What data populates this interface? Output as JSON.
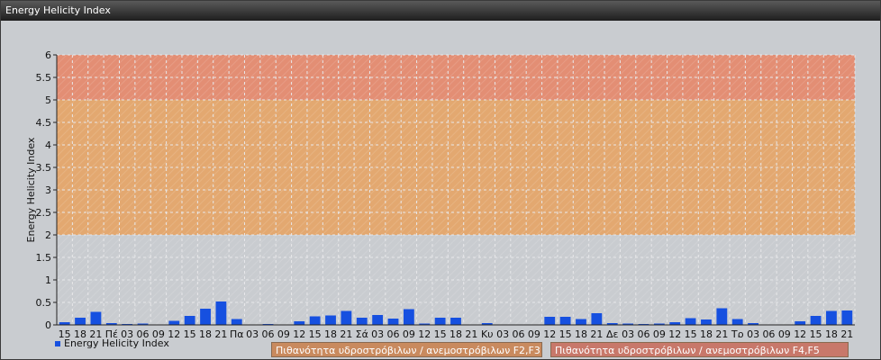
{
  "window": {
    "title": "Energy Helicity Index"
  },
  "legend": {
    "series_label": "Energy Helicity Index"
  },
  "bands": [
    {
      "label": "Πιθανότητα υδροστρόβιλων / ανεμοστρόβιλων F2,F3",
      "from": 2,
      "to": 5,
      "color": "#e3a870"
    },
    {
      "label": "Πιθανότητα υδροστρόβιλων / ανεμοστρόβιλων F4,F5",
      "from": 5,
      "to": 6,
      "color": "#e38e74"
    }
  ],
  "colors": {
    "bar": "#1650e0",
    "plot_bg": "#c9ccd0",
    "grid": "#e8e8ea"
  },
  "chart_data": {
    "type": "bar",
    "ylabel": "Energy Helicity Index",
    "ylim": [
      0,
      6
    ],
    "yticks": [
      "0",
      "0.5",
      "1",
      "1.5",
      "2",
      "2.5",
      "3",
      "3.5",
      "4",
      "4.5",
      "5",
      "5.5",
      "6"
    ],
    "grid": true,
    "categories": [
      "15",
      "18",
      "21",
      "Πέ",
      "03",
      "06",
      "09",
      "12",
      "15",
      "18",
      "21",
      "Πα",
      "03",
      "06",
      "09",
      "12",
      "15",
      "18",
      "21",
      "Σά",
      "03",
      "06",
      "09",
      "12",
      "15",
      "18",
      "21",
      "Κυ",
      "03",
      "06",
      "09",
      "12",
      "15",
      "18",
      "21",
      "Δε",
      "03",
      "06",
      "09",
      "12",
      "15",
      "18",
      "21",
      "Τρ",
      "03",
      "06",
      "09",
      "12",
      "15",
      "18",
      "21"
    ],
    "series": [
      {
        "name": "Energy Helicity Index",
        "values": [
          0.06,
          0.16,
          0.29,
          0.04,
          0.02,
          0.03,
          0.01,
          0.09,
          0.2,
          0.36,
          0.52,
          0.13,
          0.01,
          0.02,
          0.01,
          0.08,
          0.19,
          0.21,
          0.31,
          0.16,
          0.22,
          0.14,
          0.35,
          0.03,
          0.16,
          0.16,
          0.01,
          0.04,
          0.01,
          0.01,
          0.01,
          0.18,
          0.18,
          0.13,
          0.26,
          0.04,
          0.03,
          0.02,
          0.03,
          0.06,
          0.15,
          0.12,
          0.37,
          0.13,
          0.04,
          0.01,
          0.01,
          0.08,
          0.2,
          0.31,
          0.32
        ]
      }
    ]
  }
}
